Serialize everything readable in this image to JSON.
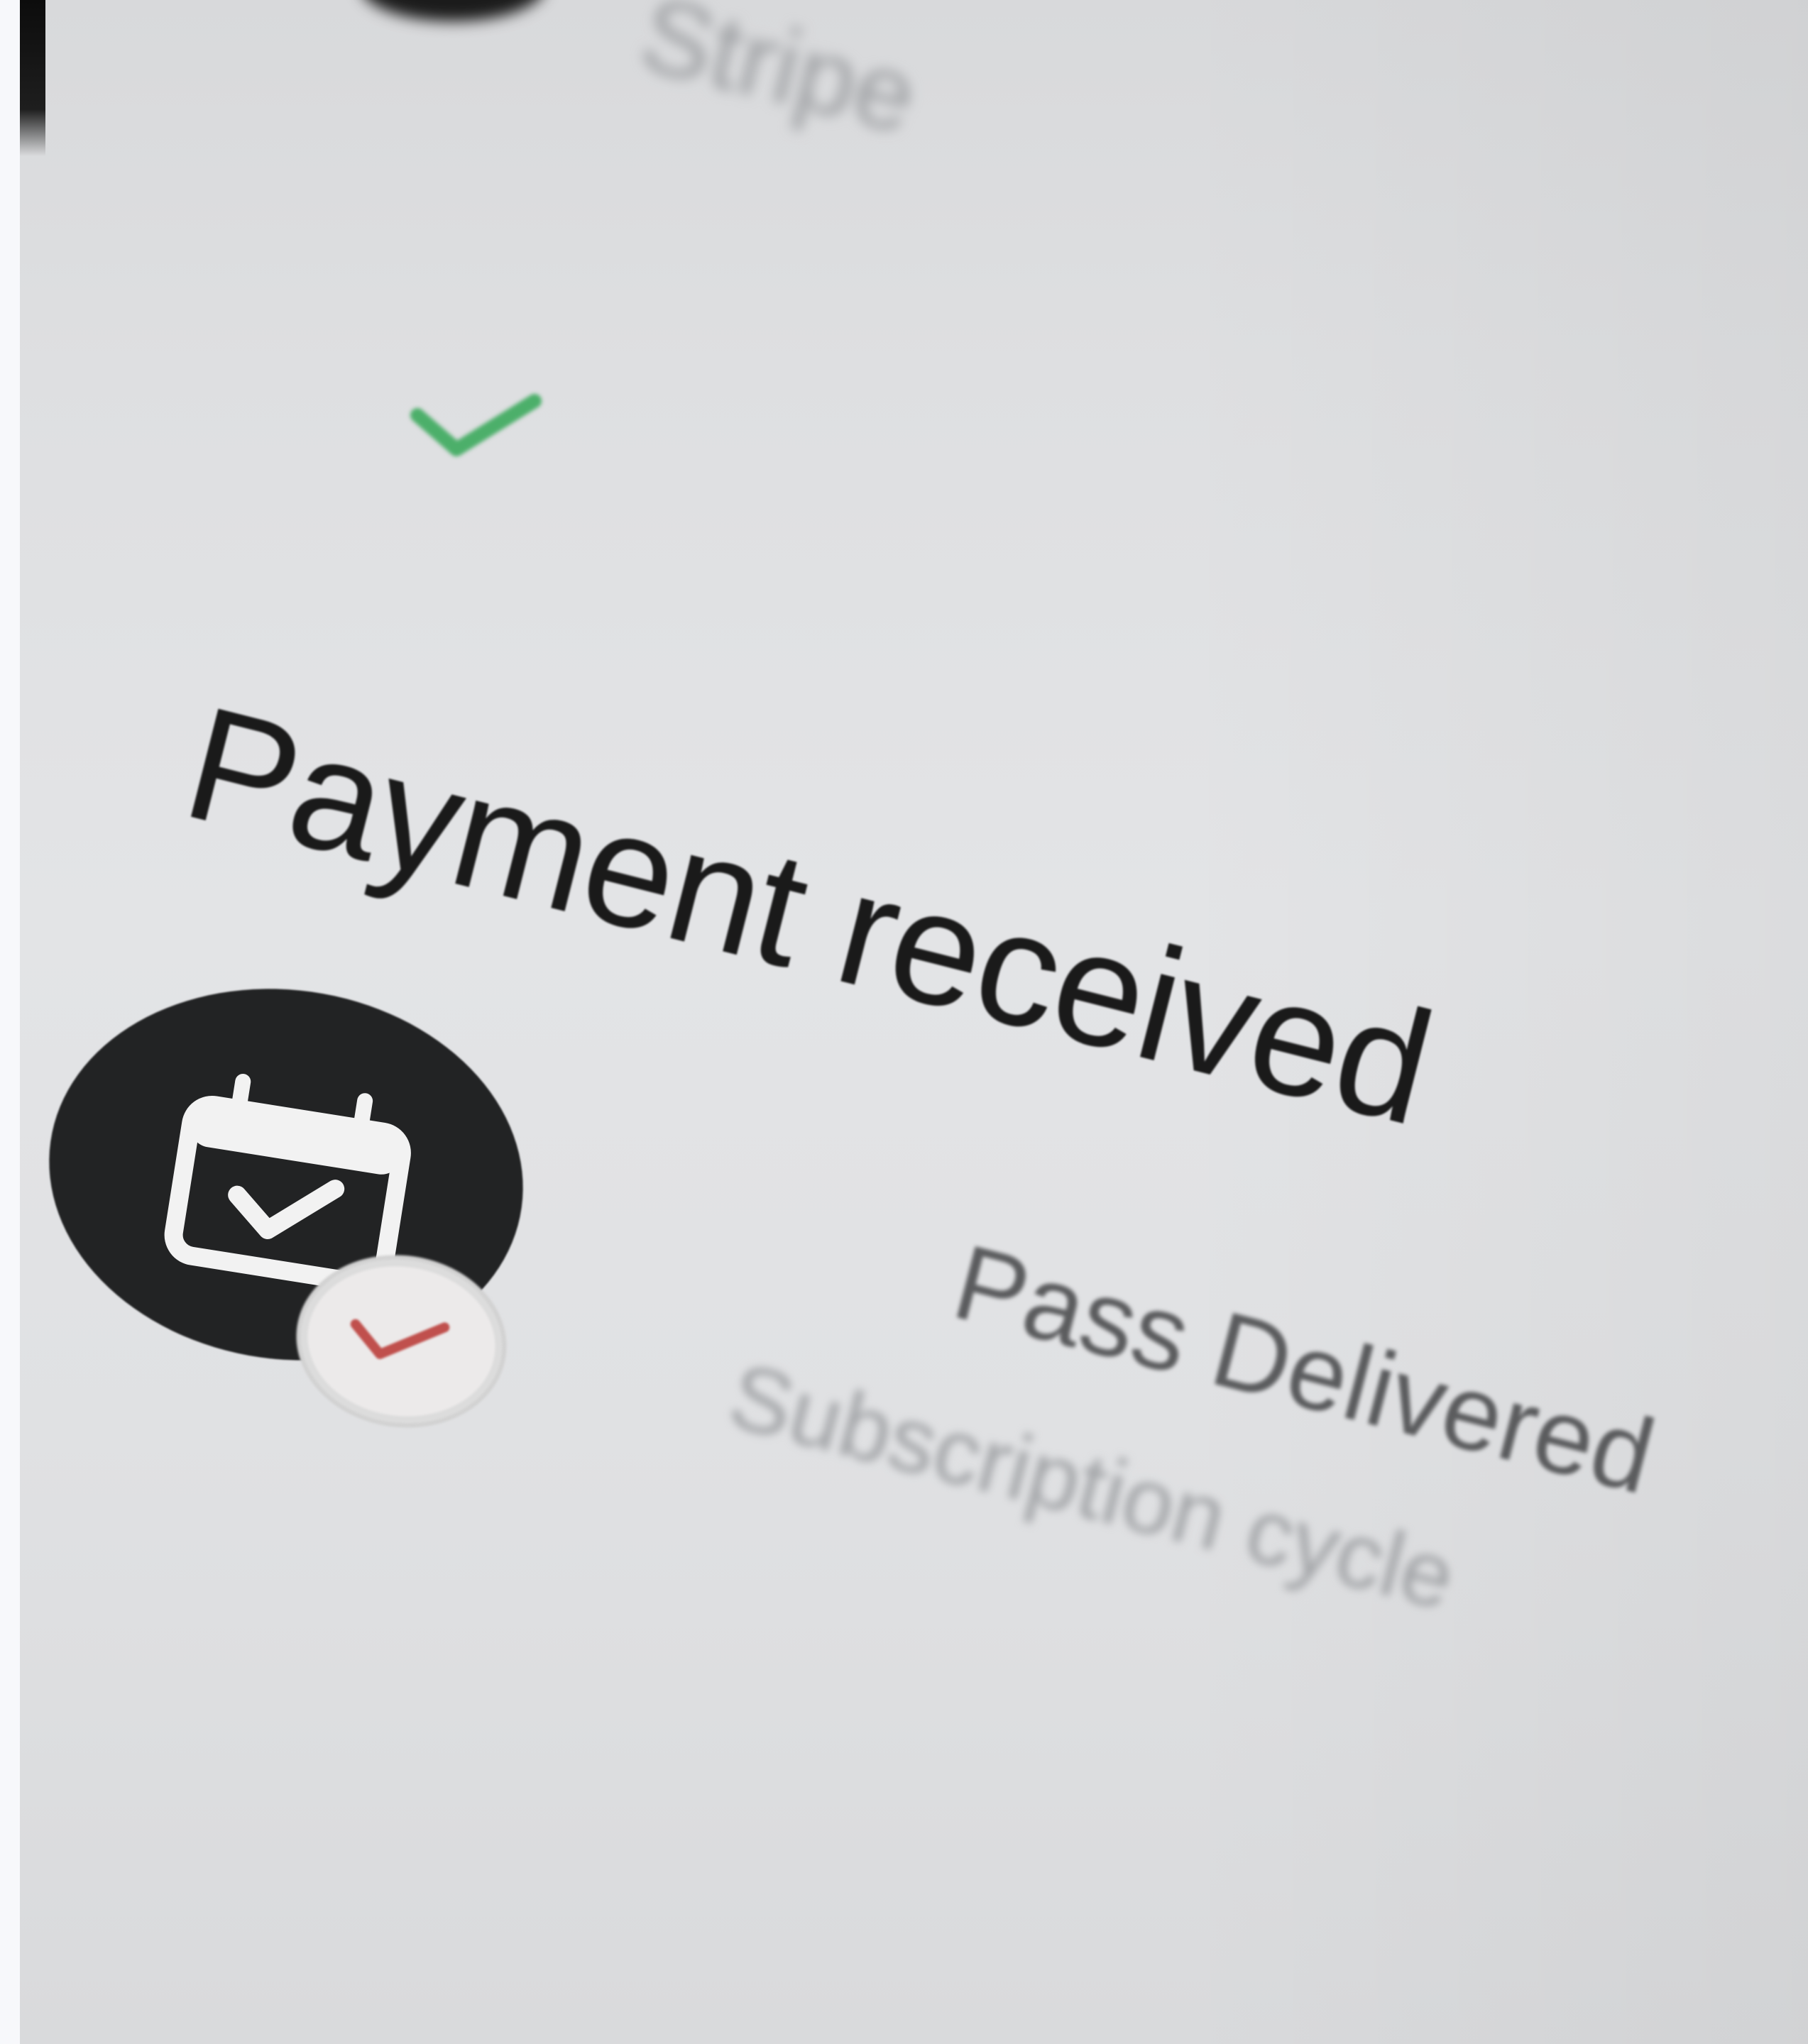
{
  "header": {
    "title": "Stripe",
    "status_check_icon": "check-icon",
    "status_check_color": "#4caf6a"
  },
  "payment": {
    "title": "Payment received"
  },
  "event": {
    "icon": "calendar-check-icon",
    "badge_icon": "check-icon",
    "badge_check_color": "#c0504d",
    "title": "Pass Delivered",
    "subtitle": "Subscription cycle"
  },
  "colors": {
    "screen_background": "#e1e2e4",
    "primary_text": "#1a1a1a",
    "secondary_text": "#5b5c5e",
    "muted_text": "#a2a4a7",
    "icon_background": "#222324"
  }
}
